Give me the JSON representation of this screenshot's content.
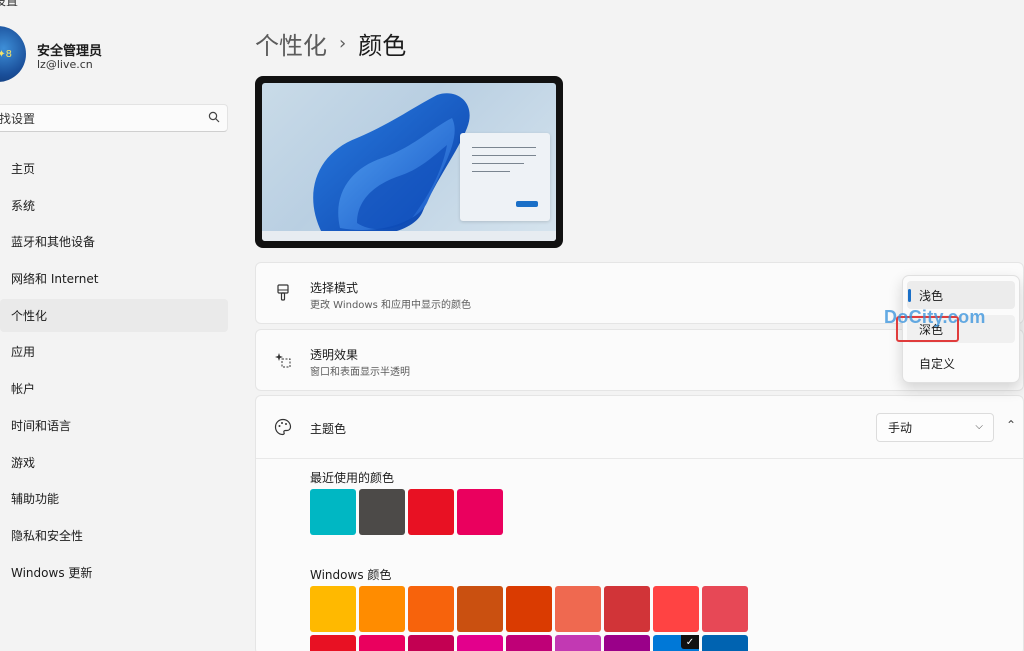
{
  "app": {
    "title": "设置"
  },
  "user": {
    "name": "安全管理员",
    "email": "lz@live.cn",
    "avatar_badge": "✦8"
  },
  "search": {
    "text": "找设置"
  },
  "sidebar": {
    "items": [
      {
        "label": "主页",
        "active": false
      },
      {
        "label": "系统",
        "active": false
      },
      {
        "label": "蓝牙和其他设备",
        "active": false
      },
      {
        "label": "网络和 Internet",
        "active": false
      },
      {
        "label": "个性化",
        "active": true
      },
      {
        "label": "应用",
        "active": false
      },
      {
        "label": "帐户",
        "active": false
      },
      {
        "label": "时间和语言",
        "active": false
      },
      {
        "label": "游戏",
        "active": false
      },
      {
        "label": "辅助功能",
        "active": false
      },
      {
        "label": "隐私和安全性",
        "active": false
      },
      {
        "label": "Windows 更新",
        "active": false
      }
    ]
  },
  "breadcrumb": {
    "parent": "个性化",
    "separator": "›",
    "current": "颜色"
  },
  "mode_card": {
    "title": "选择模式",
    "subtitle": "更改 Windows 和应用中显示的颜色"
  },
  "transparency_card": {
    "title": "透明效果",
    "subtitle": "窗口和表面显示半透明"
  },
  "accent_card": {
    "title": "主题色",
    "dropdown_value": "手动",
    "recent_label": "最近使用的颜色",
    "recent_colors": [
      "#00b7c3",
      "#4c4a48",
      "#e81123",
      "#ea005e"
    ],
    "windows_label": "Windows 颜色",
    "windows_colors_row1": [
      "#ffb900",
      "#ff8c00",
      "#f7630c",
      "#ca5010",
      "#da3b01",
      "#ef6950",
      "#d13438",
      "#ff4343",
      "#e74856"
    ],
    "windows_colors_row2": [
      "#e81123",
      "#ea005e",
      "#c30052",
      "#e3008c",
      "#bf0077",
      "#c239b3",
      "#9a0089",
      "#0078d7",
      "#0063b1"
    ],
    "selected_color": "#0078d7"
  },
  "mode_dropdown": {
    "options": [
      {
        "label": "浅色",
        "selected": true
      },
      {
        "label": "深色",
        "selected": false
      },
      {
        "label": "自定义",
        "selected": false
      }
    ]
  },
  "watermark": {
    "text": "DoCity.com"
  },
  "colors": {
    "accent": "#1a6fc7",
    "annotation": "#e03c3c"
  }
}
